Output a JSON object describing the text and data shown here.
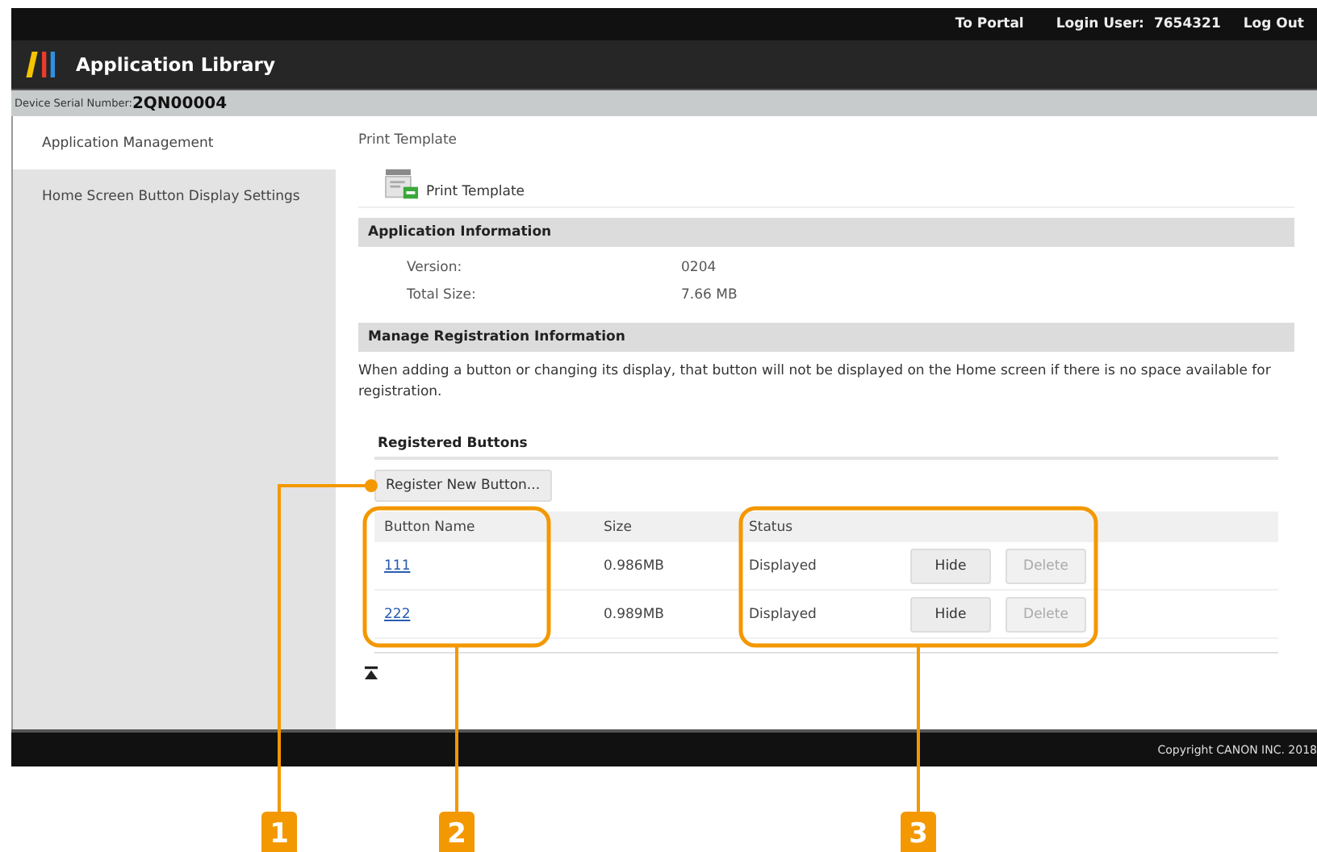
{
  "top_bar": {
    "links": [
      "To Portal"
    ],
    "login_label": "Login User:",
    "login_user": "7654321",
    "logout": "Log Out"
  },
  "header": {
    "title": "Application Library"
  },
  "serial": {
    "label": "Device Serial Number:",
    "value": "2QN00004"
  },
  "sidebar": {
    "items": [
      {
        "label": "Application Management",
        "selected": true
      },
      {
        "label": "Home Screen Button Display Settings",
        "selected": false
      }
    ]
  },
  "content": {
    "breadcrumb": "Print Template",
    "app_name": "Print Template",
    "app_info": {
      "heading": "Application Information",
      "rows": [
        {
          "label": "Version:",
          "value": "0204"
        },
        {
          "label": "Total Size:",
          "value": "7.66 MB"
        }
      ]
    },
    "manage": {
      "heading": "Manage Registration Information",
      "note": "When adding a button or changing its display, that button will not be displayed on the Home screen if there is no space available for registration.",
      "registered_heading": "Registered Buttons",
      "register_button": "Register New Button...",
      "columns": [
        "Button Name",
        "Size",
        "Status"
      ],
      "rows": [
        {
          "name": "111",
          "size": "0.986MB",
          "status": "Displayed",
          "hide": "Hide",
          "delete": "Delete",
          "delete_disabled": true
        },
        {
          "name": "222",
          "size": "0.989MB",
          "status": "Displayed",
          "hide": "Hide",
          "delete": "Delete",
          "delete_disabled": true
        }
      ]
    }
  },
  "footer": {
    "copyright": "Copyright CANON INC. 2018"
  },
  "callouts": [
    "1",
    "2",
    "3"
  ]
}
